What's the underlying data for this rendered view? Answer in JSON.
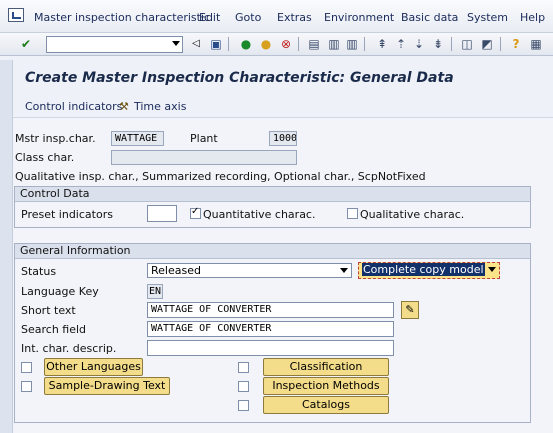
{
  "menu": {
    "items": [
      {
        "label": "Master inspection characteristic"
      },
      {
        "label": "Edit"
      },
      {
        "label": "Goto"
      },
      {
        "label": "Extras"
      },
      {
        "label": "Environment"
      },
      {
        "label": "Basic data"
      },
      {
        "label": "System"
      },
      {
        "label": "Help"
      }
    ]
  },
  "toolbar": {
    "command_value": ""
  },
  "title": "Create Master Inspection Characteristic: General Data",
  "app_toolbar": {
    "control_indicators": "Control indicators",
    "time_axis": "Time axis"
  },
  "header": {
    "mstr_label": "Mstr insp.char.",
    "mstr_value": "WATTAGE",
    "plant_label": "Plant",
    "plant_value": "1000",
    "class_label": "Class char.",
    "class_value": "",
    "summary_text": "Qualitative insp. char., Summarized recording, Optional char., ScpNotFixed"
  },
  "control_data": {
    "title": "Control Data",
    "preset_label": "Preset indicators",
    "preset_value": "",
    "quantitative_label": "Quantitative charac.",
    "quantitative_checked": true,
    "qualitative_label": "Qualitative charac.",
    "qualitative_checked": false
  },
  "general_info": {
    "title": "General Information",
    "status_label": "Status",
    "status_value": "Released",
    "copy_model_value": "Complete copy model",
    "language_label": "Language Key",
    "language_value": "EN",
    "short_text_label": "Short text",
    "short_text_value": "WATTAGE OF CONVERTER",
    "search_label": "Search field",
    "search_value": "WATTAGE OF CONVERTER",
    "intchar_label": "Int. char. descrip.",
    "intchar_value": ""
  },
  "buttons": {
    "other_languages": "Other Languages",
    "sample_drawing": "Sample-Drawing Text",
    "classification": "Classification",
    "inspection_methods": "Inspection Methods",
    "catalogs": "Catalogs"
  }
}
